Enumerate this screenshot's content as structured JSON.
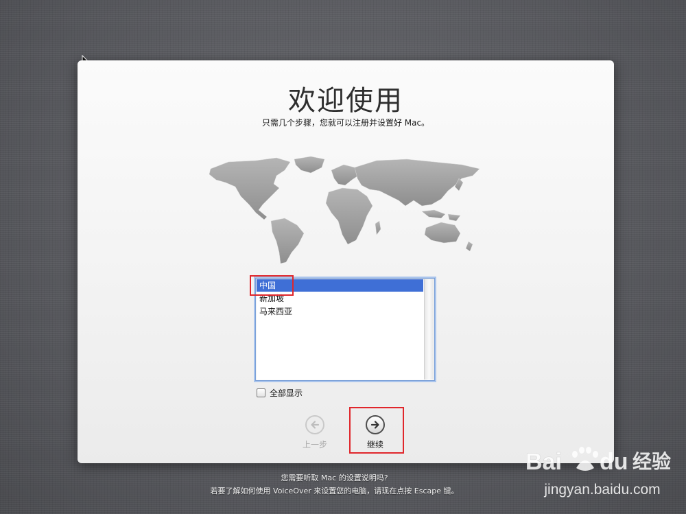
{
  "window": {
    "title": "欢迎使用",
    "subtitle": "只需几个步骤，您就可以注册并设置好 Mac。"
  },
  "country_list": {
    "items": [
      {
        "label": "中国",
        "selected": true
      },
      {
        "label": "新加坡",
        "selected": false
      },
      {
        "label": "马来西亚",
        "selected": false
      }
    ]
  },
  "show_all": {
    "label": "全部显示",
    "checked": false
  },
  "navigation": {
    "back_label": "上一步",
    "continue_label": "继续"
  },
  "footer": {
    "line1": "您需要听取 Mac 的设置说明吗?",
    "line2": "若要了解如何使用 VoiceOver 来设置您的电脑，请现在点按 Escape 键。"
  },
  "watermark": {
    "brand": "Baidu 经验",
    "url": "jingyan.baidu.com"
  },
  "colors": {
    "selection": "#3f6fd6",
    "annotation": "#e0262b",
    "desktop": "#5d5e62"
  },
  "icons": [
    "arrow-pointer-icon",
    "world-map",
    "back-arrow-icon",
    "forward-arrow-icon",
    "paw-icon"
  ]
}
